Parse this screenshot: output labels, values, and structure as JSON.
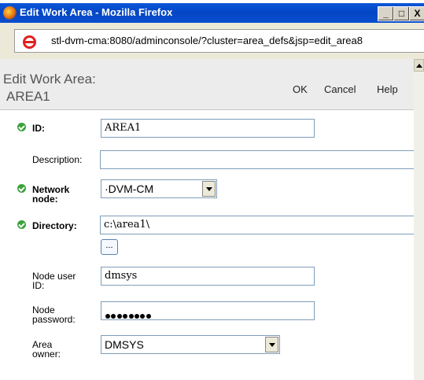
{
  "window": {
    "title": "Edit Work Area - Mozilla Firefox",
    "minimize": "_",
    "maximize": "□",
    "close": "X"
  },
  "browser": {
    "url": "stl-dvm-cma:8080/adminconsole/?cluster=area_defs&jsp=edit_area8"
  },
  "page": {
    "title_line1": "Edit Work Area:",
    "title_line2": "AREA1",
    "ok": "OK",
    "cancel": "Cancel",
    "help": "Help"
  },
  "form": {
    "id": {
      "label": "ID:",
      "value": "AREA1",
      "required": true
    },
    "description": {
      "label": "Description:",
      "value": ""
    },
    "network_node": {
      "label_line1": "Network",
      "label_line2": "node:",
      "value": "·DVM-CM",
      "required": true
    },
    "directory": {
      "label": "Directory:",
      "value": "c:\\area1\\",
      "browse_label": "...",
      "required": true
    },
    "node_user_id": {
      "label_line1": "Node user",
      "label_line2": "ID:",
      "value": "dmsys"
    },
    "node_password": {
      "label_line1": "Node",
      "label_line2": "password:",
      "masked_length": 8
    },
    "area_owner": {
      "label_line1": "Area",
      "label_line2": "owner:",
      "value": "DMSYS"
    }
  }
}
